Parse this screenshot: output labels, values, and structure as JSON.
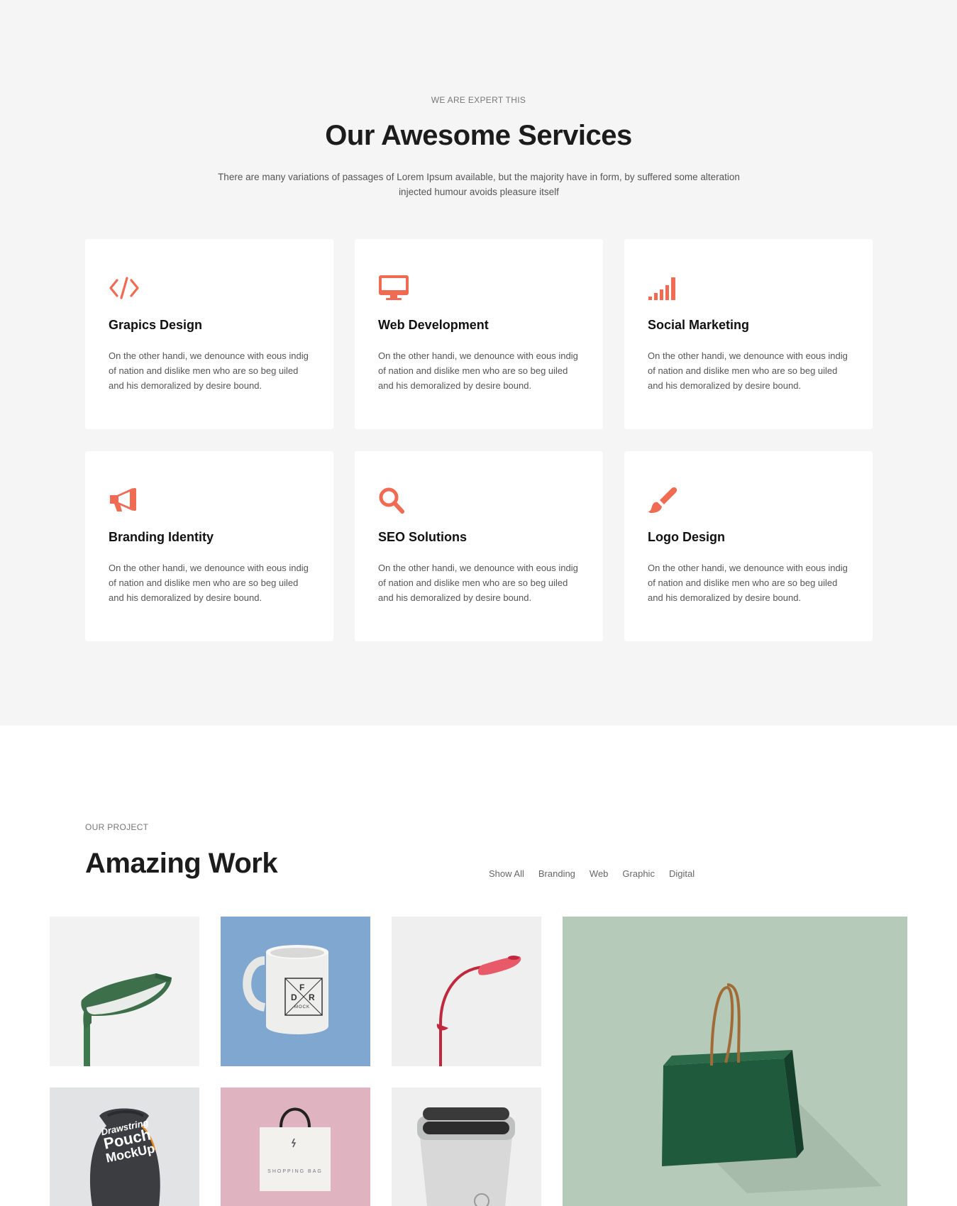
{
  "services": {
    "eyebrow": "WE ARE EXPERT THIS",
    "title": "Our Awesome Services",
    "description": "There are many variations of passages of Lorem Ipsum available, but the majority have in form, by suffered some alteration injected humour avoids pleasure itself",
    "accent_color": "#ef6b54",
    "cards": [
      {
        "icon": "code-icon",
        "title": "Grapics Design",
        "text": "On the other handi, we denounce with eous indig of nation and dislike men who are so beg uiled and his demoralized by desire bound."
      },
      {
        "icon": "monitor-icon",
        "title": "Web Development",
        "text": "On the other handi, we denounce with eous indig of nation and dislike men who are so beg uiled and his demoralized by desire bound."
      },
      {
        "icon": "signal-bars-icon",
        "title": "Social Marketing",
        "text": "On the other handi, we denounce with eous indig of nation and dislike men who are so beg uiled and his demoralized by desire bound."
      },
      {
        "icon": "megaphone-icon",
        "title": "Branding Identity",
        "text": "On the other handi, we denounce with eous indig of nation and dislike men who are so beg uiled and his demoralized by desire bound."
      },
      {
        "icon": "search-icon",
        "title": "SEO Solutions",
        "text": "On the other handi, we denounce with eous indig of nation and dislike men who are so beg uiled and his demoralized by desire bound."
      },
      {
        "icon": "paint-brush-icon",
        "title": "Logo Design",
        "text": "On the other handi, we denounce with eous indig of nation and dislike men who are so beg uiled and his demoralized by desire bound."
      }
    ]
  },
  "work": {
    "eyebrow": "OUR PROJECT",
    "title": "Amazing Work",
    "filters": [
      "Show All",
      "Branding",
      "Web",
      "Graphic",
      "Digital"
    ],
    "projects": [
      {
        "name": "green-lamp-image"
      },
      {
        "name": "mug-mockup-image",
        "logo_text": [
          "D",
          "F",
          "R",
          "MOCK"
        ]
      },
      {
        "name": "red-lamp-image"
      },
      {
        "name": "green-shopping-bag-image"
      },
      {
        "name": "drawstring-pouch-image",
        "print_text": [
          "Drawstring",
          "Pouch",
          "MockUp"
        ]
      },
      {
        "name": "shopping-bag-mockup-image",
        "print_text": [
          "SHOPPING BAG"
        ]
      },
      {
        "name": "shaver-image"
      }
    ]
  }
}
